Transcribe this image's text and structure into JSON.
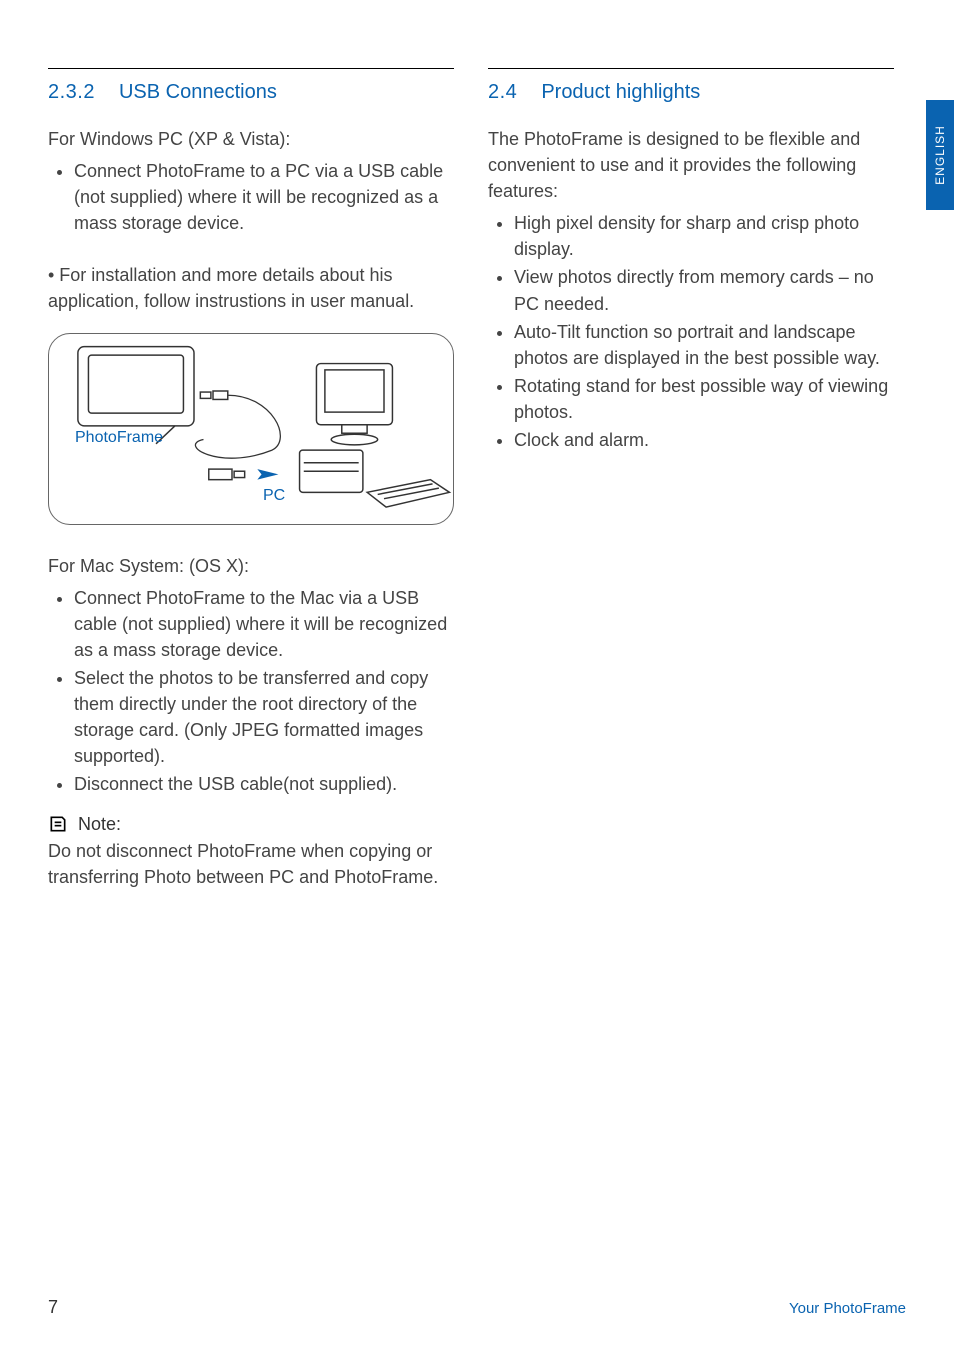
{
  "sideTab": "ENGLISH",
  "left": {
    "headingNum": "2.3.2",
    "headingTitle": "USB Connections",
    "winIntro": "For Windows PC (XP & Vista):",
    "winItems": [
      "Connect PhotoFrame to a PC via a USB cable (not supplied) where it will be recognized as a mass storage device."
    ],
    "winPara2": "•  For installation and more details about his application, follow instrustions in user manual.",
    "diagram": {
      "labelPhotoFrame": "PhotoFrame",
      "labelPC": "PC"
    },
    "macIntro": "For Mac System: (OS X):",
    "macItems": [
      "Connect PhotoFrame to the Mac via a USB cable (not supplied) where it will be recognized as a mass storage device.",
      "Select the photos to be transferred and copy them directly under the root directory of the storage card. (Only JPEG formatted images supported).",
      "Disconnect the USB cable(not supplied)."
    ],
    "noteLabel": "Note:",
    "noteBody": "Do not disconnect PhotoFrame when copying or transferring Photo between PC and PhotoFrame."
  },
  "right": {
    "headingNum": "2.4",
    "headingTitle": "Product   highlights",
    "intro": "The PhotoFrame is designed to be flexible and convenient to use and it provides the following features:",
    "items": [
      "High pixel density for sharp and crisp photo display.",
      "View photos directly from memory cards – no PC needed.",
      "Auto-Tilt function so portrait and landscape photos are displayed in the best possible way.",
      "Rotating stand for best possible way of viewing photos.",
      "Clock and alarm."
    ]
  },
  "footer": {
    "pageNumber": "7",
    "rightText": "Your PhotoFrame"
  }
}
